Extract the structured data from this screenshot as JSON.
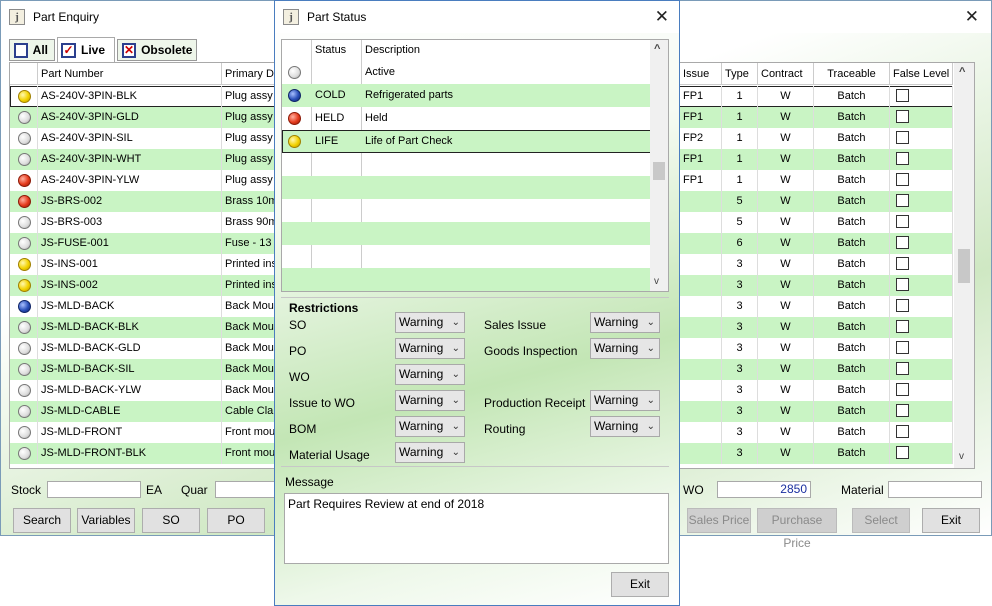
{
  "part_enquiry": {
    "title": "Part Enquiry",
    "tabs": [
      {
        "label": "All",
        "mark": ""
      },
      {
        "label": "Live",
        "mark": "✓"
      },
      {
        "label": "Obsolete",
        "mark": "✕"
      }
    ],
    "columns": {
      "part_number": "Part Number",
      "primary_desc": "Primary De",
      "issue": "Issue",
      "type": "Type",
      "contract": "Contract",
      "traceable": "Traceable",
      "false_level": "False Level"
    },
    "rows": [
      {
        "status": "yellow",
        "part": "AS-240V-3PIN-BLK",
        "desc": "Plug assy",
        "issue": "FP1",
        "type": "1",
        "contract": "W",
        "trace": "Batch"
      },
      {
        "status": "grey",
        "part": "AS-240V-3PIN-GLD",
        "desc": "Plug assy",
        "issue": "FP1",
        "type": "1",
        "contract": "W",
        "trace": "Batch"
      },
      {
        "status": "grey",
        "part": "AS-240V-3PIN-SIL",
        "desc": "Plug assy",
        "issue": "FP2",
        "type": "1",
        "contract": "W",
        "trace": "Batch"
      },
      {
        "status": "grey",
        "part": "AS-240V-3PIN-WHT",
        "desc": "Plug assy",
        "issue": "FP1",
        "type": "1",
        "contract": "W",
        "trace": "Batch"
      },
      {
        "status": "red",
        "part": "AS-240V-3PIN-YLW",
        "desc": "Plug assy",
        "issue": "FP1",
        "type": "1",
        "contract": "W",
        "trace": "Batch"
      },
      {
        "status": "red",
        "part": "JS-BRS-002",
        "desc": "Brass 10m",
        "issue": "",
        "type": "5",
        "contract": "W",
        "trace": "Batch"
      },
      {
        "status": "grey",
        "part": "JS-BRS-003",
        "desc": "Brass 90m",
        "issue": "",
        "type": "5",
        "contract": "W",
        "trace": "Batch"
      },
      {
        "status": "grey",
        "part": "JS-FUSE-001",
        "desc": "Fuse - 13",
        "issue": "",
        "type": "6",
        "contract": "W",
        "trace": "Batch"
      },
      {
        "status": "yellow",
        "part": "JS-INS-001",
        "desc": "Printed ins",
        "issue": "",
        "type": "3",
        "contract": "W",
        "trace": "Batch"
      },
      {
        "status": "yellow",
        "part": "JS-INS-002",
        "desc": "Printed ins",
        "issue": "",
        "type": "3",
        "contract": "W",
        "trace": "Batch"
      },
      {
        "status": "blue",
        "part": "JS-MLD-BACK",
        "desc": "Back Moul",
        "issue": "",
        "type": "3",
        "contract": "W",
        "trace": "Batch"
      },
      {
        "status": "grey",
        "part": "JS-MLD-BACK-BLK",
        "desc": "Back Moul",
        "issue": "",
        "type": "3",
        "contract": "W",
        "trace": "Batch"
      },
      {
        "status": "grey",
        "part": "JS-MLD-BACK-GLD",
        "desc": "Back Moul",
        "issue": "",
        "type": "3",
        "contract": "W",
        "trace": "Batch"
      },
      {
        "status": "grey",
        "part": "JS-MLD-BACK-SIL",
        "desc": "Back Moul",
        "issue": "",
        "type": "3",
        "contract": "W",
        "trace": "Batch"
      },
      {
        "status": "grey",
        "part": "JS-MLD-BACK-YLW",
        "desc": "Back Moul",
        "issue": "",
        "type": "3",
        "contract": "W",
        "trace": "Batch"
      },
      {
        "status": "grey",
        "part": "JS-MLD-CABLE",
        "desc": "Cable Clan",
        "issue": "",
        "type": "3",
        "contract": "W",
        "trace": "Batch"
      },
      {
        "status": "grey",
        "part": "JS-MLD-FRONT",
        "desc": "Front mou",
        "issue": "",
        "type": "3",
        "contract": "W",
        "trace": "Batch"
      },
      {
        "status": "grey",
        "part": "JS-MLD-FRONT-BLK",
        "desc": "Front mou",
        "issue": "",
        "type": "3",
        "contract": "W",
        "trace": "Batch"
      }
    ],
    "stock_label": "Stock",
    "ea_label": "EA",
    "quar_label": "Quar",
    "wo_label": "WO",
    "wo_value": "2850",
    "material_label": "Material",
    "buttons": {
      "search": "Search",
      "variables": "Variables",
      "so": "SO",
      "po": "PO",
      "sales_price": "Sales Price",
      "purchase_price": "Purchase Price",
      "select": "Select",
      "exit": "Exit"
    }
  },
  "part_status": {
    "title": "Part Status",
    "columns": {
      "status": "Status",
      "description": "Description"
    },
    "rows": [
      {
        "dot": "grey",
        "status": "",
        "desc": "Active"
      },
      {
        "dot": "blue",
        "status": "COLD",
        "desc": "Refrigerated parts"
      },
      {
        "dot": "red",
        "status": "HELD",
        "desc": "Held"
      },
      {
        "dot": "yellow",
        "status": "LIFE",
        "desc": "Life of Part Check"
      }
    ],
    "restrictions_title": "Restrictions",
    "restrictions_left": [
      {
        "label": "SO",
        "value": "Warning"
      },
      {
        "label": "PO",
        "value": "Warning"
      },
      {
        "label": "WO",
        "value": "Warning"
      },
      {
        "label": "Issue to WO",
        "value": "Warning"
      },
      {
        "label": "BOM",
        "value": "Warning"
      },
      {
        "label": "Material Usage",
        "value": "Warning"
      }
    ],
    "restrictions_right": [
      {
        "label": "Sales Issue",
        "value": "Warning"
      },
      {
        "label": "Goods Inspection",
        "value": "Warning"
      },
      {
        "label": "Production Receipt",
        "value": "Warning"
      },
      {
        "label": "Routing",
        "value": "Warning"
      }
    ],
    "message_label": "Message",
    "message_text": "Part Requires Review at end of 2018",
    "exit_label": "Exit"
  },
  "colors": {
    "green_row": "#c9f4c4",
    "title_border": "#4a7dbf"
  }
}
